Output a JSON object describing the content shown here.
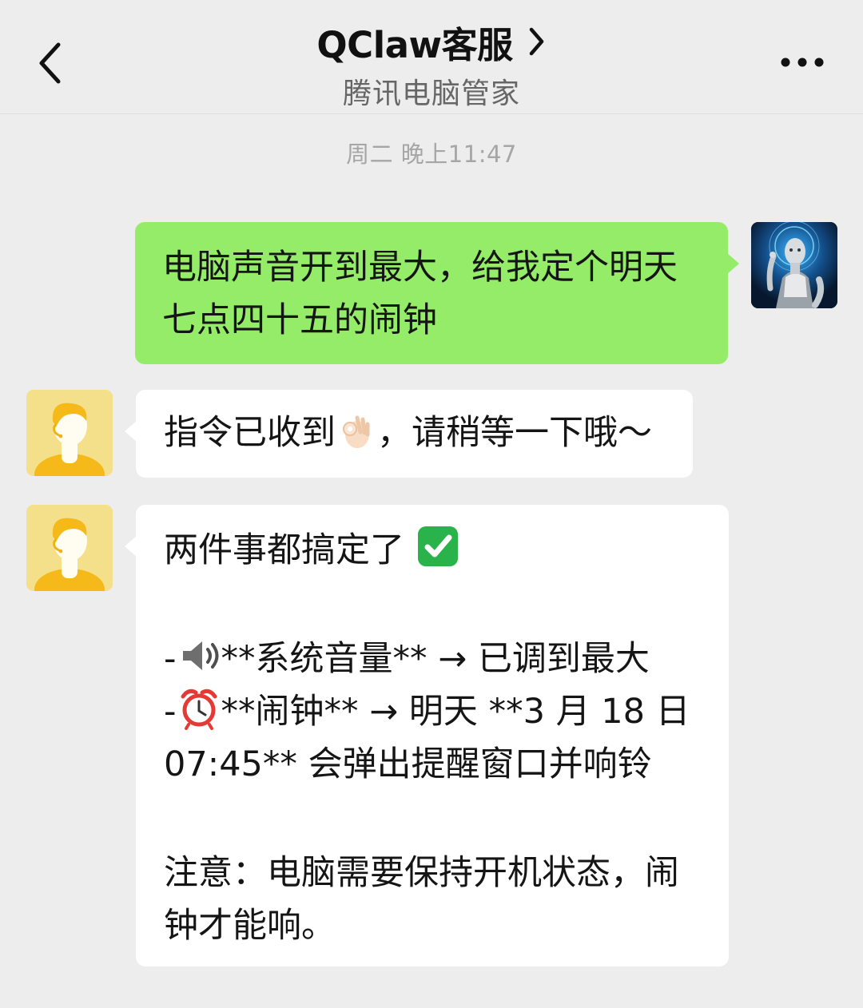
{
  "header": {
    "title": "QClaw客服",
    "subtitle": "腾讯电脑管家"
  },
  "conversation": {
    "timestamp": "周二 晚上11:47",
    "messages": [
      {
        "sender": "user",
        "lines": [
          "电脑声音开到最大，给我定个明天",
          "七点四十五的闹钟"
        ]
      },
      {
        "sender": "bot",
        "text_before_emoji": "指令已收到",
        "text_after_emoji": "，请稍等一下哦～"
      },
      {
        "sender": "bot",
        "title": "两件事都搞定了",
        "item_1": {
          "prefix": "-",
          "text": "**系统音量** → 已调到最大"
        },
        "item_2": {
          "prefix": "-",
          "text_line_1": "**闹钟** → 明天 **3 月 18 日",
          "text_line_2": "07:45** 会弹出提醒窗口并响铃"
        },
        "note_lines": [
          "注意：电脑需要保持开机状态，闹",
          "钟才能响。"
        ]
      }
    ]
  },
  "icons": {
    "back": "chevron-left-icon",
    "title_arrow": "chevron-right-icon",
    "more": "more-dots-icon",
    "ok": "ok-hand-emoji",
    "check": "check-mark-button-emoji",
    "speaker": "speaker-high-volume-emoji",
    "alarm": "alarm-clock-emoji"
  },
  "colors": {
    "background": "#ededed",
    "user_bubble": "#95ec69",
    "bot_bubble": "#ffffff",
    "timestamp": "#a6a6a6",
    "check_green": "#29b34a"
  }
}
